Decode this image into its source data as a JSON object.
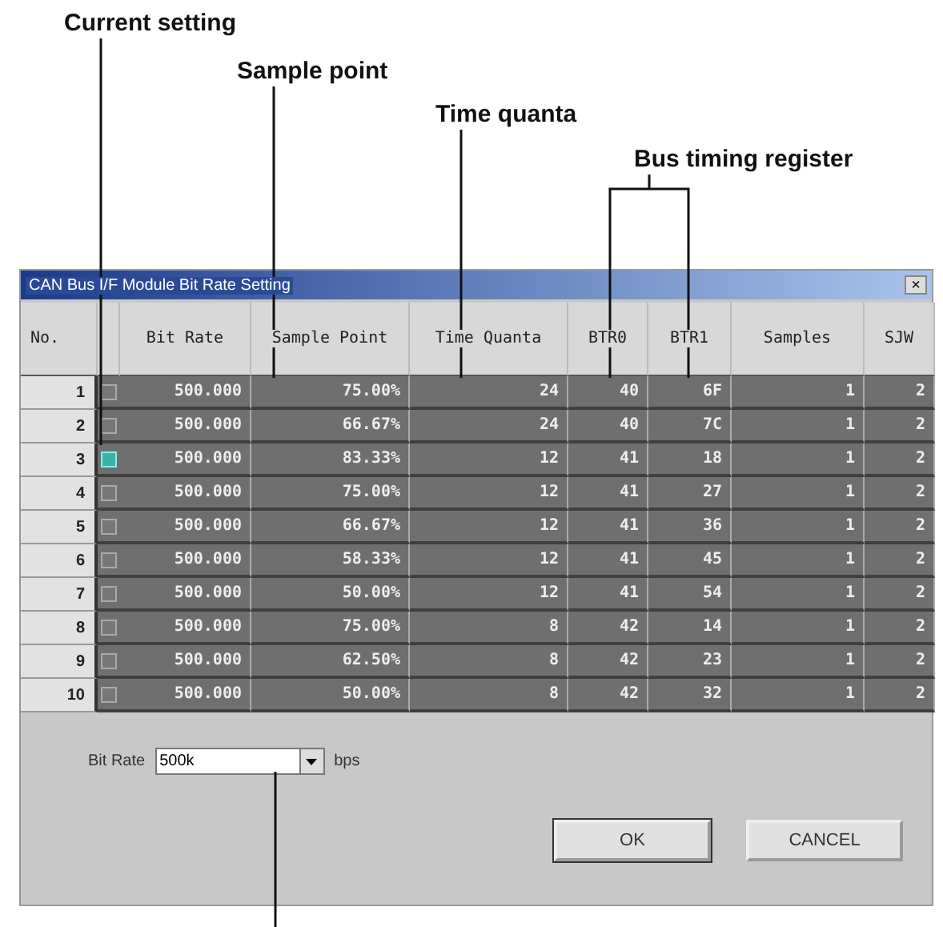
{
  "annotations": [
    "Current setting",
    "Sample point",
    "Time quanta",
    "Bus timing register"
  ],
  "window": {
    "title": "CAN Bus I/F Module Bit Rate Setting",
    "close": "×"
  },
  "table": {
    "columns": [
      "No.",
      "Bit Rate",
      "Sample Point",
      "Time Quanta",
      "BTR0",
      "BTR1",
      "Samples",
      "SJW"
    ],
    "rows": [
      {
        "no": "1",
        "checked": false,
        "bit_rate": "500.000",
        "sample_point": "75.00%",
        "time_quanta": "24",
        "btr0": "40",
        "btr1": "6F",
        "samples": "1",
        "sjw": "2"
      },
      {
        "no": "2",
        "checked": false,
        "bit_rate": "500.000",
        "sample_point": "66.67%",
        "time_quanta": "24",
        "btr0": "40",
        "btr1": "7C",
        "samples": "1",
        "sjw": "2"
      },
      {
        "no": "3",
        "checked": true,
        "bit_rate": "500.000",
        "sample_point": "83.33%",
        "time_quanta": "12",
        "btr0": "41",
        "btr1": "18",
        "samples": "1",
        "sjw": "2"
      },
      {
        "no": "4",
        "checked": false,
        "bit_rate": "500.000",
        "sample_point": "75.00%",
        "time_quanta": "12",
        "btr0": "41",
        "btr1": "27",
        "samples": "1",
        "sjw": "2"
      },
      {
        "no": "5",
        "checked": false,
        "bit_rate": "500.000",
        "sample_point": "66.67%",
        "time_quanta": "12",
        "btr0": "41",
        "btr1": "36",
        "samples": "1",
        "sjw": "2"
      },
      {
        "no": "6",
        "checked": false,
        "bit_rate": "500.000",
        "sample_point": "58.33%",
        "time_quanta": "12",
        "btr0": "41",
        "btr1": "45",
        "samples": "1",
        "sjw": "2"
      },
      {
        "no": "7",
        "checked": false,
        "bit_rate": "500.000",
        "sample_point": "50.00%",
        "time_quanta": "12",
        "btr0": "41",
        "btr1": "54",
        "samples": "1",
        "sjw": "2"
      },
      {
        "no": "8",
        "checked": false,
        "bit_rate": "500.000",
        "sample_point": "75.00%",
        "time_quanta": "8",
        "btr0": "42",
        "btr1": "14",
        "samples": "1",
        "sjw": "2"
      },
      {
        "no": "9",
        "checked": false,
        "bit_rate": "500.000",
        "sample_point": "62.50%",
        "time_quanta": "8",
        "btr0": "42",
        "btr1": "23",
        "samples": "1",
        "sjw": "2"
      },
      {
        "no": "10",
        "checked": false,
        "bit_rate": "500.000",
        "sample_point": "50.00%",
        "time_quanta": "8",
        "btr0": "42",
        "btr1": "32",
        "samples": "1",
        "sjw": "2"
      }
    ]
  },
  "bit_rate": {
    "label": "Bit Rate",
    "value": "500k",
    "unit": "bps"
  },
  "buttons": [
    "OK",
    "CANCEL"
  ]
}
